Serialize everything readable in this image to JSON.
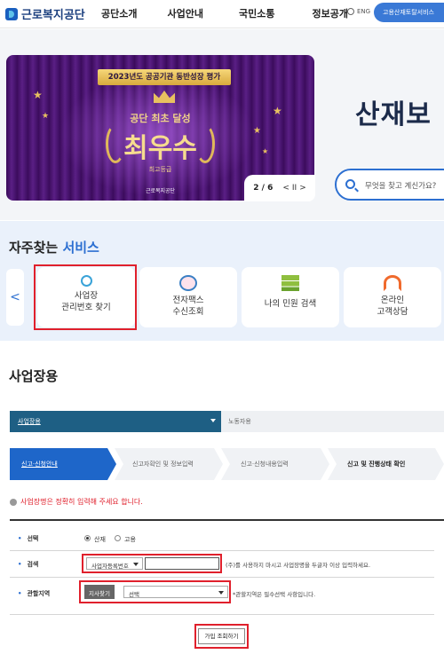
{
  "header": {
    "logo_text": "근로복지공단",
    "nav": [
      "공단소개",
      "사업안내",
      "국민소통",
      "정보공개"
    ],
    "lang": "ENG",
    "top_button": "고용산재토탈서비스"
  },
  "hero": {
    "banner": {
      "badge": "2023년도 공공기관 동반성장 평가",
      "subtitle": "공단 최초 달성",
      "main": "최우수",
      "grade": "최고등급",
      "org": "근로복지공단"
    },
    "pager": {
      "text": "2 / 6",
      "prev": "<",
      "pause": "II",
      "next": ">"
    },
    "title": "산재보",
    "search_placeholder": "무엇을 찾고 계신가요?"
  },
  "services": {
    "title_main": "자주찾는",
    "title_accent": "서비스",
    "prev_arrow": "<",
    "items": [
      {
        "line1": "사업장",
        "line2": "관리번호 찾기",
        "icon": "magnifier-icon"
      },
      {
        "line1": "전자팩스",
        "line2": "수신조회",
        "icon": "fax-search-icon"
      },
      {
        "line1": "나의 민원 검색",
        "line2": "",
        "icon": "documents-icon"
      },
      {
        "line1": "온라인",
        "line2": "고객상담",
        "icon": "headset-icon"
      }
    ]
  },
  "business": {
    "title": "사업장용",
    "tab_active": "사업장용",
    "tab_inactive": "노동자용",
    "steps": [
      "신고·신청안내",
      "신고자확인 및 정보입력",
      "신고·신청내용입력",
      "신고 및 진행상태 확인"
    ],
    "notice": "사업장명은 정확히 입력해 주세요 합니다.",
    "form": {
      "choice_label": "선택",
      "choice_options": [
        "산재",
        "고용"
      ],
      "choice_selected": "산재",
      "search_label": "검색",
      "search_select": "사업자등록번호",
      "search_value": "",
      "search_hint": "(주)를 사용하지 마시고 사업장명을 두글자 이상 입력하세요.",
      "region_label": "관할지역",
      "branch_button": "지사찾기",
      "region_select": "선택",
      "region_hint": "*관할지역은 필수선택 사항입니다.",
      "join_button": "가입 조회하기"
    }
  },
  "colors": {
    "brand": "#1b3f7e",
    "accent": "#2c6fd1",
    "highlight": "#e0202c",
    "tab_dark": "#1e5f84"
  }
}
